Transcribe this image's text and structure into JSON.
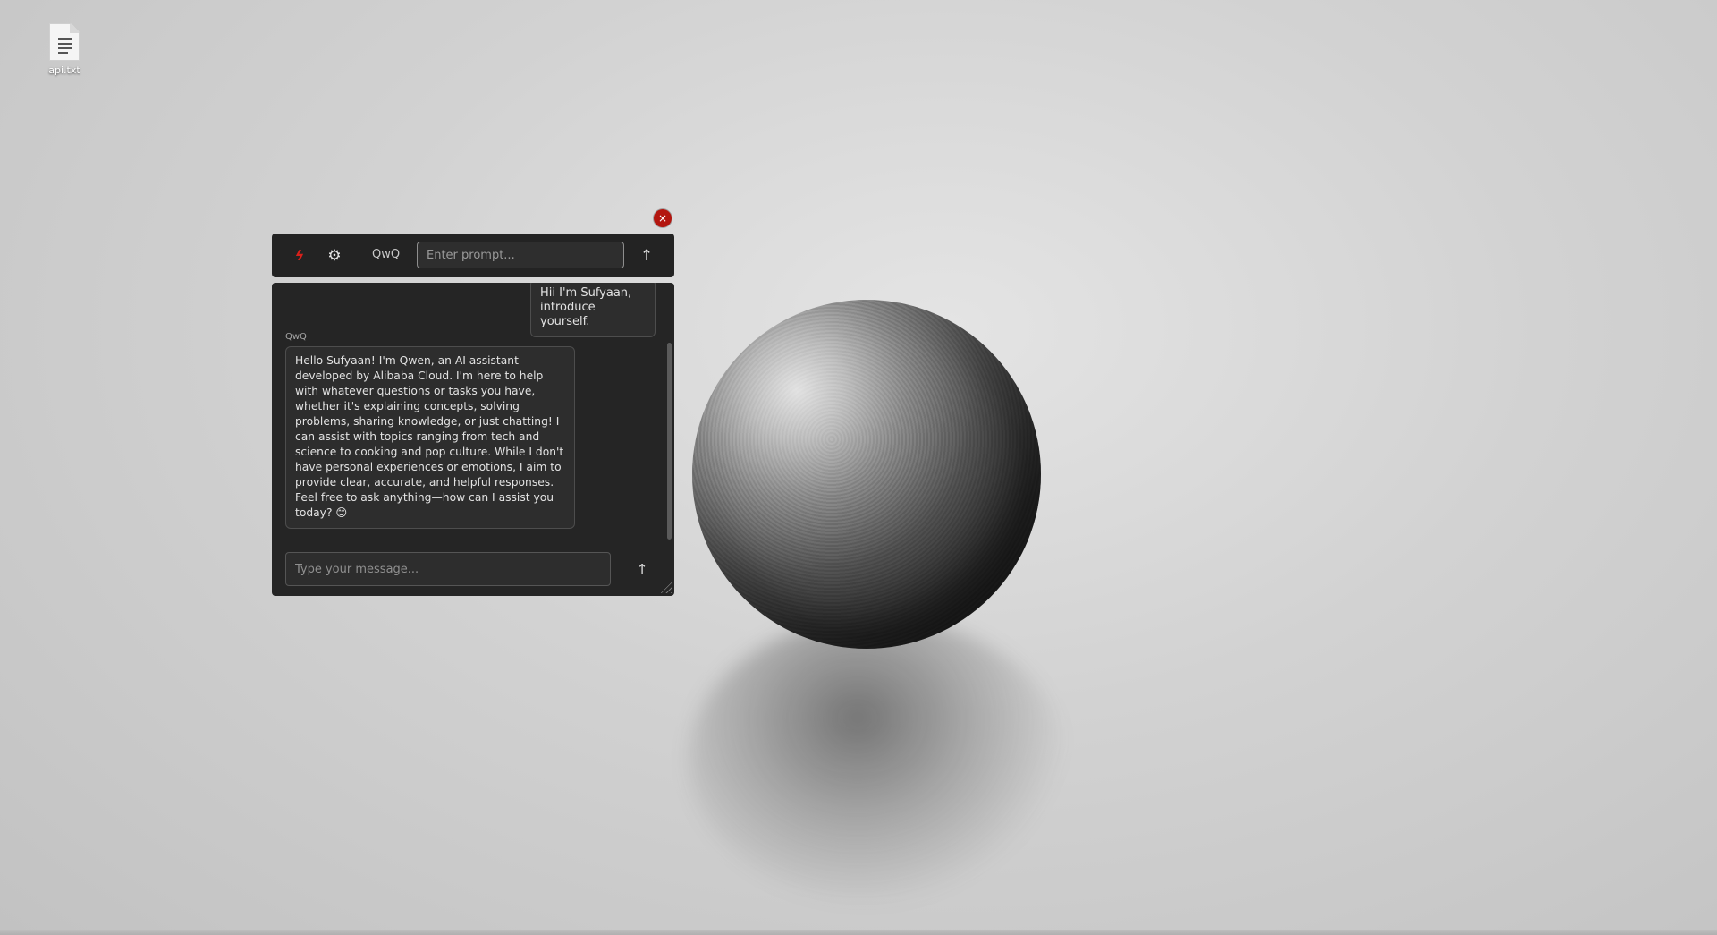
{
  "desktop": {
    "file_icon": "text-file-icon",
    "file_label": "api.txt"
  },
  "widget": {
    "close_glyph": "×",
    "brand_icon": "bolt-icon",
    "brand_glyph": "ϟ",
    "settings_icon": "gear-icon",
    "settings_glyph": "⚙",
    "model_label": "QwQ",
    "prompt_placeholder": "Enter prompt...",
    "send_glyph": "↑"
  },
  "chat": {
    "user_message": "Hii I'm Sufyaan, introduce yourself.",
    "assistant_name": "QwQ",
    "assistant_message": "Hello Sufyaan! I'm Qwen, an AI assistant developed by Alibaba Cloud. I'm here to help with whatever questions or tasks you have, whether it's explaining concepts, solving problems, sharing knowledge, or just chatting! I can assist with topics ranging from tech and science to cooking and pop culture. While I don't have personal experiences or emotions, I aim to provide clear, accurate, and helpful responses. Feel free to ask anything—how can I assist you today? 😊",
    "input_placeholder": "Type your message...",
    "send_glyph": "↑"
  },
  "colors": {
    "panel_bg": "#232323",
    "accent_red": "#d8201a",
    "close_red": "#b3160f"
  }
}
